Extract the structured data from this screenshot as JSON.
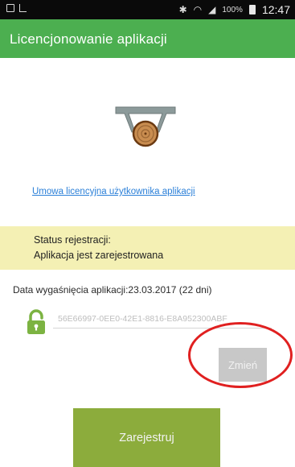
{
  "status_bar": {
    "battery_percent": "100%",
    "time": "12:47",
    "icons": [
      "screenshot-icon",
      "sim-icon",
      "bluetooth-icon",
      "wifi-icon",
      "signal-icon",
      "battery-icon"
    ]
  },
  "header": {
    "title": "Licencjonowanie aplikacji",
    "color": "#4caf50"
  },
  "license_link": {
    "label": "Umowa licencyjna użytkownika aplikacji"
  },
  "registration": {
    "status_label": "Status rejestracji:",
    "status_value": "Aplikacja jest zarejestrowana",
    "box_color": "#f4f0b4"
  },
  "expiry": {
    "text": "Data wygaśnięcia aplikacji:23.03.2017 (22 dni)"
  },
  "license_key": {
    "value": "56E66997-0EE0-42E1-8816-E8A952300ABF",
    "lock_icon": "unlocked-padlock-icon",
    "lock_color": "#7cb342"
  },
  "buttons": {
    "change_label": "Zmień",
    "register_label": "Zarejestruj"
  }
}
